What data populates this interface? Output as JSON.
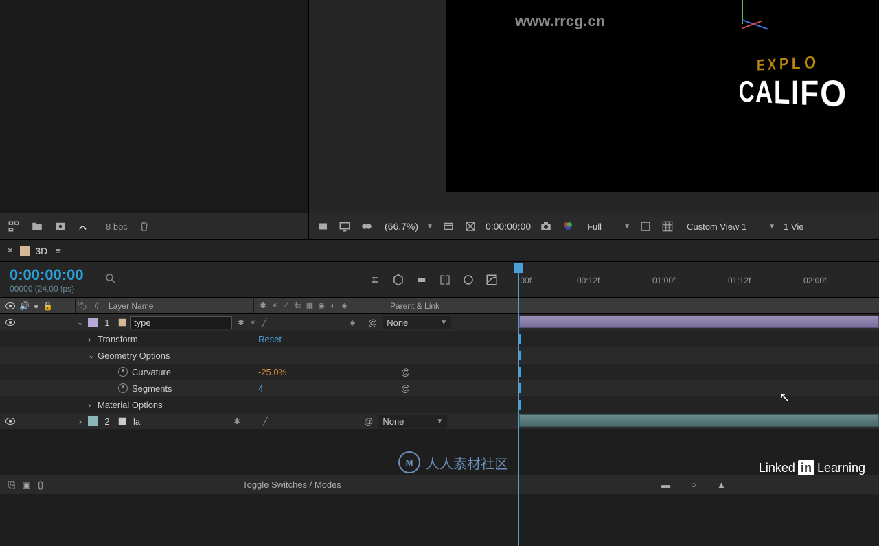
{
  "watermark_url": "www.rrcg.cn",
  "watermark_text": "人人素材社区",
  "viewer": {
    "line1": "EXPLO",
    "line2": "CALIFO"
  },
  "project_bar": {
    "bpc": "8 bpc"
  },
  "comp_bar": {
    "zoom": "(66.7%)",
    "timecode": "0:00:00:00",
    "resolution": "Full",
    "view_mode": "Custom View 1",
    "view_count": "1 Vie"
  },
  "tab": {
    "name": "3D"
  },
  "timeline_header": {
    "timecode": "0:00:00:00",
    "sub": "00000 (24.00 fps)"
  },
  "ruler": {
    "t0": ":00f",
    "t1": "00:12f",
    "t2": "01:00f",
    "t3": "01:12f",
    "t4": "02:00f"
  },
  "columns": {
    "num": "#",
    "layer_name": "Layer Name",
    "parent": "Parent & Link"
  },
  "layers": [
    {
      "num": "1",
      "name": "type",
      "color": "#b8a8d8",
      "parent": "None",
      "transform_label": "Transform",
      "transform_reset": "Reset",
      "geometry_label": "Geometry Options",
      "curvature_label": "Curvature",
      "curvature_value": "-25.0%",
      "segments_label": "Segments",
      "segments_value": "4",
      "material_label": "Material Options"
    },
    {
      "num": "2",
      "name": "la",
      "color": "#88b8b8",
      "parent": "None"
    }
  ],
  "bottom": {
    "toggle_label": "Toggle Switches / Modes"
  },
  "linkedin": {
    "prefix": "Linked",
    "box": "in",
    "suffix": "Learning"
  }
}
